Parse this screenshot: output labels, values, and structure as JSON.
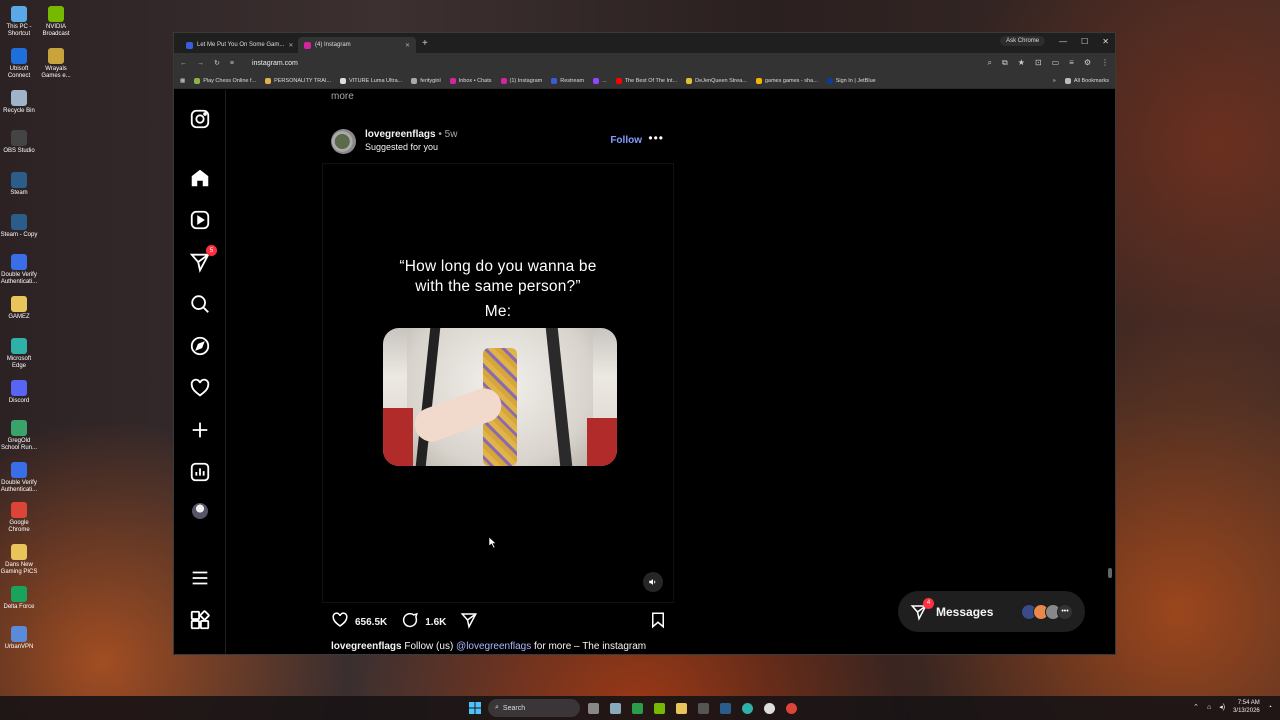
{
  "desktop": {
    "icons": [
      {
        "label": "This PC - Shortcut",
        "color": "#5aa9e6"
      },
      {
        "label": "NVIDIA Broadcast",
        "color": "#76b900"
      },
      {
        "label": "Ubisoft Connect",
        "color": "#1e6fd9"
      },
      {
        "label": "Wrayals Games e...",
        "color": "#c9a33b"
      },
      {
        "label": "Recycle Bin",
        "color": "#9fb4c8"
      },
      {
        "label": "OBS Studio",
        "color": "#444"
      },
      {
        "label": "Steam",
        "color": "#2a5d8a"
      },
      {
        "label": "Steam - Copy",
        "color": "#2a5d8a"
      },
      {
        "label": "Double Verify Authenticati...",
        "color": "#3a6ee8"
      },
      {
        "label": "GAMEZ",
        "color": "#e8c45a"
      },
      {
        "label": "Microsoft Edge",
        "color": "#2fb0a8"
      },
      {
        "label": "Discord",
        "color": "#5865f2"
      },
      {
        "label": "GregOld School Run...",
        "color": "#3aa36b"
      },
      {
        "label": "Double Verify Authenticati...",
        "color": "#3a6ee8"
      },
      {
        "label": "Google Chrome",
        "color": "#db4437"
      },
      {
        "label": "Dans New Gaming PICS",
        "color": "#e8c45a"
      },
      {
        "label": "Delta Force",
        "color": "#1aa35c"
      },
      {
        "label": "UrbanVPN",
        "color": "#5a8ad8"
      }
    ]
  },
  "browser": {
    "tabs": [
      {
        "title": "Let Me Put You On Some Gam...",
        "active": false,
        "favicon_color": "#3b5bdb"
      },
      {
        "title": "(4) Instagram",
        "active": true,
        "favicon_color": "#d6249f"
      }
    ],
    "new_tab_label": "+",
    "ask_chrome_label": "Ask Chrome",
    "url": "instagram.com",
    "bookmarks": [
      {
        "label": "Play Chess Online f...",
        "color": "#8bb34a"
      },
      {
        "label": "PERSONALITY TRAI...",
        "color": "#e0b34a"
      },
      {
        "label": "VITURE Luma Ultra...",
        "color": "#ddd"
      },
      {
        "label": "ferityginl",
        "color": "#aaa"
      },
      {
        "label": "Inbox • Chats",
        "color": "#d6249f"
      },
      {
        "label": "(1) Instagram",
        "color": "#d6249f"
      },
      {
        "label": "Restream",
        "color": "#3b5bdb"
      },
      {
        "label": "...",
        "color": "#9146ff"
      },
      {
        "label": "The Best Of The Int...",
        "color": "#ff0000"
      },
      {
        "label": "DeJenQueen Strea...",
        "color": "#e0c030"
      },
      {
        "label": "games games - sha...",
        "color": "#f4b400"
      },
      {
        "label": "Sign In | JetBlue",
        "color": "#0b3d91"
      }
    ],
    "all_bookmarks_label": "All Bookmarks"
  },
  "instagram": {
    "nav": [
      {
        "name": "instagram-logo-icon"
      },
      {
        "name": "home-icon"
      },
      {
        "name": "reels-icon"
      },
      {
        "name": "messages-icon",
        "badge": "5"
      },
      {
        "name": "search-icon"
      },
      {
        "name": "explore-icon"
      },
      {
        "name": "notifications-icon"
      },
      {
        "name": "create-icon"
      },
      {
        "name": "dashboard-icon"
      },
      {
        "name": "profile-avatar"
      },
      {
        "name": "menu-icon"
      },
      {
        "name": "also-from-meta-icon"
      }
    ],
    "prev_post_more": "more",
    "post": {
      "username": "lovegreenflags",
      "time": " • 5w",
      "subtitle": "Suggested for you",
      "follow_label": "Follow",
      "media_text_line1": "“How long do you wanna be",
      "media_text_line2": "with the same person?”",
      "media_text_line3": "Me:",
      "likes": "656.5K",
      "comments": "1.6K",
      "caption_user": "lovegreenflags",
      "caption_text_1": " Follow (us) ",
      "caption_mention": "@lovegreenflags",
      "caption_text_2": " for more – The instagram"
    },
    "messages": {
      "label": "Messages",
      "badge": "4"
    }
  },
  "taskbar": {
    "search_placeholder": "Search",
    "time": "7:54 AM",
    "date": "3/13/2026"
  }
}
